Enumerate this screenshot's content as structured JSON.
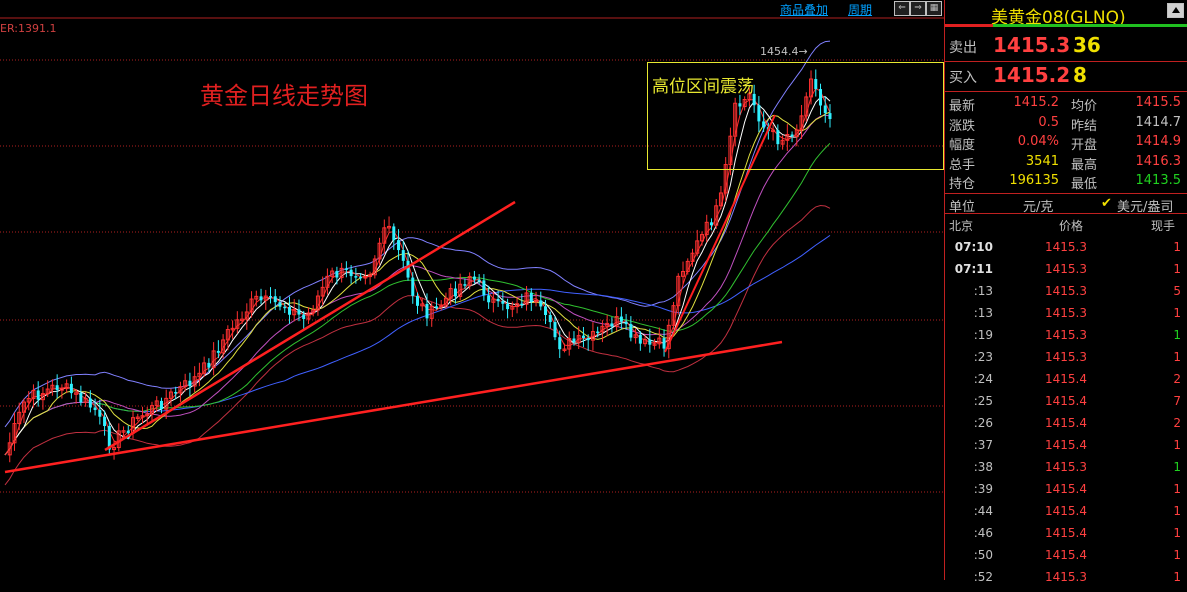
{
  "toolbar": {
    "overlay_label": "商品叠加",
    "period_label": "周期"
  },
  "chart": {
    "er_text": "ER:1391.1",
    "title": "黄金日线走势图",
    "box_label": "高位区间震荡",
    "peak_label": "1454.4→"
  },
  "chart_data": {
    "type": "candlestick",
    "title": "黄金日线走势图",
    "annotations": [
      "高位区间震荡",
      "1454.4",
      "ER:1391.1"
    ],
    "peak_high": 1454.4,
    "trendlines": [
      "rising support line (lower)",
      "rising support line (upper)"
    ],
    "colors": {
      "up": "#ff3030",
      "down": "#30f0ff",
      "bg": "#000000"
    }
  },
  "panel": {
    "title": "美黄金08(GLNQ)",
    "sell": {
      "label": "卖出",
      "price": "1415.3",
      "qty": "36"
    },
    "buy": {
      "label": "买入",
      "price": "1415.2",
      "qty": "8"
    },
    "stats": [
      {
        "l1": "最新",
        "v1": "1415.2",
        "c1": "r",
        "l2": "均价",
        "v2": "1415.5",
        "c2": "r"
      },
      {
        "l1": "涨跌",
        "v1": "0.5",
        "c1": "r",
        "l2": "昨结",
        "v2": "1414.7",
        "c2": "w"
      },
      {
        "l1": "幅度",
        "v1": "0.04%",
        "c1": "r",
        "l2": "开盘",
        "v2": "1414.9",
        "c2": "r"
      },
      {
        "l1": "总手",
        "v1": "3541",
        "c1": "y",
        "l2": "最高",
        "v2": "1416.3",
        "c2": "r"
      },
      {
        "l1": "持仓",
        "v1": "196135",
        "c1": "y",
        "l2": "最低",
        "v2": "1413.5",
        "c2": "g"
      }
    ],
    "unit": {
      "label": "单位",
      "value": "元/克",
      "check_label": "美元/盎司"
    },
    "ticks_header": {
      "time": "北京",
      "price": "价格",
      "vol": "现手"
    },
    "ticks": [
      {
        "time": "07:10",
        "price": "1415.3",
        "vol": "1",
        "vc": "r"
      },
      {
        "time": "07:11",
        "price": "1415.3",
        "vol": "1",
        "vc": "r"
      },
      {
        "time": ":13",
        "price": "1415.3",
        "vol": "5",
        "vc": "r"
      },
      {
        "time": ":13",
        "price": "1415.3",
        "vol": "1",
        "vc": "r"
      },
      {
        "time": ":19",
        "price": "1415.3",
        "vol": "1",
        "vc": "g"
      },
      {
        "time": ":23",
        "price": "1415.3",
        "vol": "1",
        "vc": "r"
      },
      {
        "time": ":24",
        "price": "1415.4",
        "vol": "2",
        "vc": "r"
      },
      {
        "time": ":25",
        "price": "1415.4",
        "vol": "7",
        "vc": "r"
      },
      {
        "time": ":26",
        "price": "1415.4",
        "vol": "2",
        "vc": "r"
      },
      {
        "time": ":37",
        "price": "1415.4",
        "vol": "1",
        "vc": "r"
      },
      {
        "time": ":38",
        "price": "1415.3",
        "vol": "1",
        "vc": "g"
      },
      {
        "time": ":39",
        "price": "1415.4",
        "vol": "1",
        "vc": "r"
      },
      {
        "time": ":44",
        "price": "1415.4",
        "vol": "1",
        "vc": "r"
      },
      {
        "time": ":46",
        "price": "1415.4",
        "vol": "1",
        "vc": "r"
      },
      {
        "time": ":50",
        "price": "1415.4",
        "vol": "1",
        "vc": "r"
      },
      {
        "time": ":52",
        "price": "1415.3",
        "vol": "1",
        "vc": "r"
      }
    ]
  }
}
